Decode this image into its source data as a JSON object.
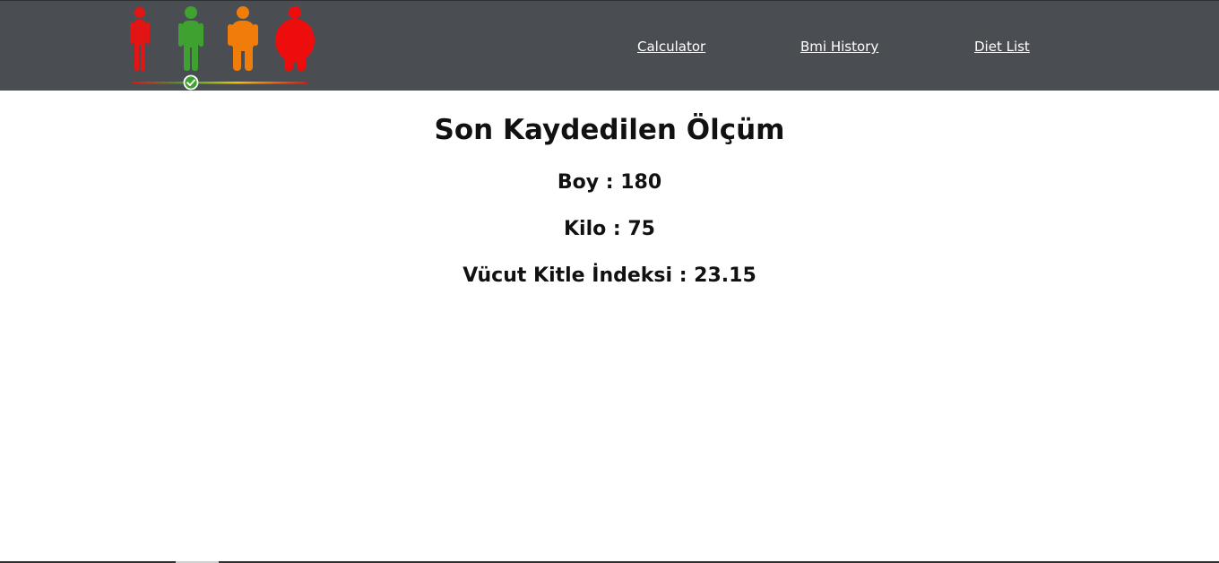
{
  "nav": {
    "links": [
      {
        "label": "Calculator"
      },
      {
        "label": "Bmi History"
      },
      {
        "label": "Diet List"
      }
    ]
  },
  "logo": {
    "icon": "bmi-figures-logo",
    "colors": {
      "underweight": "#e21414",
      "normal": "#3fa12f",
      "overweight": "#f07d0a",
      "obese": "#ee0d0d"
    }
  },
  "main": {
    "title": "Son Kaydedilen Ölçüm",
    "height_label": "Boy : 180",
    "weight_label": "Kilo : 75",
    "bmi_label": "Vücut Kitle İndeksi : 23.15"
  },
  "colors": {
    "navbar_bg": "#4a4e52",
    "nav_link": "#ffffff",
    "text": "#111111"
  }
}
